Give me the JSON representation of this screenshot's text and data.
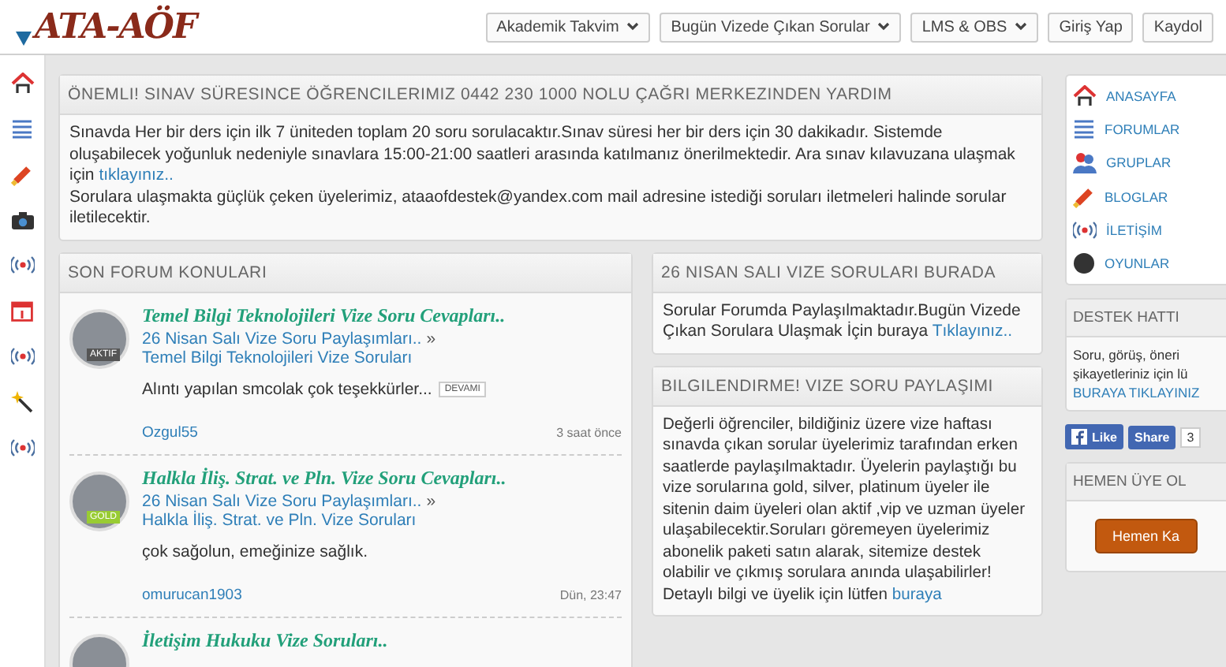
{
  "header": {
    "logo": "ATA-AÖF",
    "nav": [
      {
        "label": "Akademik Takvim",
        "dropdown": true
      },
      {
        "label": "Bugün Vizede Çıkan Sorular",
        "dropdown": true
      },
      {
        "label": "LMS & OBS",
        "dropdown": true
      },
      {
        "label": "Giriş Yap",
        "dropdown": false
      },
      {
        "label": "Kaydol",
        "dropdown": false
      }
    ]
  },
  "notice": {
    "title": "ÖNEMLI! SINAV SÜRESINCE ÖĞRENCILERIMIZ 0442 230 1000 NOLU ÇAĞRI MERKEZINDEN YARDIM",
    "paragraphs": [
      {
        "text": "Sınavda Her bir ders için ilk 7 üniteden toplam 20 soru sorulacaktır.Sınav süresi her bir ders için 30 dakikadır. Sistemde oluşabilecek yoğunluk nedeniyle sınavlara 15:00-21:00 saatleri arasında katılmanız önerilmektedir. Ara sınav kılavuzana ulaşmak için",
        "link": "tıklayınız.."
      },
      {
        "text": "Sorulara ulaşmakta güçlük çeken üyelerimiz, ataaofdestek@yandex.com mail adresine istediği soruları iletmeleri halinde sorular iletilecektir."
      }
    ]
  },
  "forum": {
    "title": "SON FORUM KONULARI",
    "posts": [
      {
        "title": "Temel Bilgi Teknolojileri Vize Soru Cevapları..",
        "badge": "AKTIF",
        "forum": "26 Nisan Salı Vize Soru Paylaşımları..",
        "separator": "»",
        "subforum": "Temel Bilgi Teknolojileri Vize Soruları",
        "excerpt": "Alıntı yapılan smcolak çok teşekkürler...",
        "more": "DEVAMI",
        "user": "Ozgul55",
        "time": "3 saat önce"
      },
      {
        "title": "Halkla İliş. Strat. ve Pln. Vize Soru Cevapları..",
        "badge": "GOLD",
        "forum": "26 Nisan Salı Vize Soru Paylaşımları..",
        "separator": "»",
        "subforum": "Halkla İliş. Strat. ve Pln. Vize Soruları",
        "excerpt": "çok sağolun, emeğinize sağlık.",
        "user": "omurucan1903",
        "time": "Dün, 23:47"
      },
      {
        "title": "İletişim Hukuku Vize Soruları.."
      }
    ]
  },
  "announce": {
    "title": "26 NISAN SALI VIZE SORULARI BURADA",
    "text": "Sorular Forumda Paylaşılmaktadır.Bugün Vizede Çıkan Sorulara Ulaşmak İçin buraya",
    "link": "Tıklayınız.."
  },
  "info": {
    "title": "BILGILENDIRME! VIZE SORU PAYLAŞIMI",
    "text": "Değerli öğrenciler, bildiğiniz üzere vize haftası sınavda çıkan sorular üyelerimiz tarafından erken saatlerde paylaşılmaktadır. Üyelerin paylaştığı bu vize sorularına gold, silver, platinum üyeler ile sitenin daim üyeleri olan aktif ,vip ve uzman üyeler ulaşabilecektir.Soruları göremeyen üyelerimiz abonelik paketi satın alarak, sitemize destek olabilir ve çıkmış sorulara anında ulaşabilirler!",
    "more_text": "Detaylı bilgi ve üyelik için lütfen",
    "more_link": "buraya"
  },
  "sidebar": {
    "menu": [
      {
        "label": "ANASAYFA"
      },
      {
        "label": "FORUMLAR"
      },
      {
        "label": "GRUPLAR"
      },
      {
        "label": "BLOGLAR"
      },
      {
        "label": "İLETİŞİM"
      },
      {
        "label": "OYUNLAR"
      }
    ],
    "support": {
      "title": "DESTEK HATTI",
      "text": "Soru, görüş, öneri şikayetleriniz için lü",
      "link": "BURAYA TIKLAYINIZ"
    },
    "social": {
      "like": "Like",
      "share": "Share",
      "count": "3"
    },
    "signup": {
      "title": "HEMEN ÜYE OL",
      "button": "Hemen Ka"
    }
  }
}
